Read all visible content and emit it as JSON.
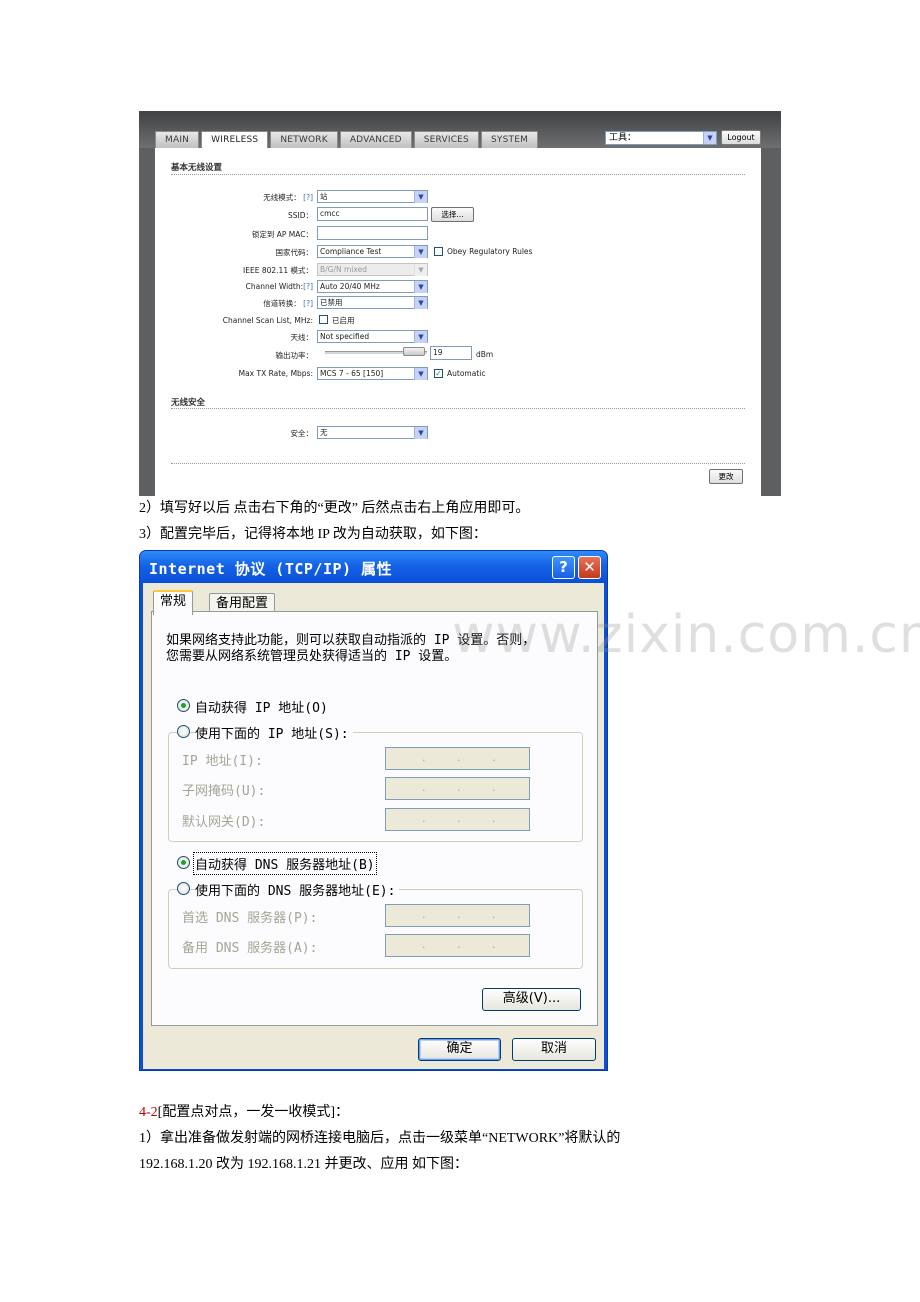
{
  "router": {
    "tabs": [
      "MAIN",
      "WIRELESS",
      "NETWORK",
      "ADVANCED",
      "SERVICES",
      "SYSTEM"
    ],
    "active_tab": "WIRELESS",
    "tools_label": "工具：",
    "logout_label": "Logout",
    "basic_section_title": "基本无线设置",
    "fields": {
      "wireless_mode": {
        "label": "无线模式：",
        "help": "[?]",
        "value": "站"
      },
      "ssid": {
        "label": "SSID：",
        "value": "cmcc",
        "select_button": "选择..."
      },
      "lock_ap_mac": {
        "label": "锁定到 AP MAC：",
        "value": ""
      },
      "country_code": {
        "label": "国家代码：",
        "value": "Compliance Test",
        "checkbox_label": "Obey Regulatory Rules"
      },
      "ieee_mode": {
        "label": "IEEE 802.11 模式：",
        "value": "B/G/N mixed"
      },
      "channel_width": {
        "label": "Channel Width:",
        "help": "[?]",
        "value": "Auto 20/40 MHz"
      },
      "channel_shift": {
        "label": "信道转换：",
        "help": "[?]",
        "value": "已禁用"
      },
      "channel_scan": {
        "label": "Channel Scan List, MHz:",
        "checkbox_label": "已启用"
      },
      "antenna": {
        "label": "天线：",
        "value": "Not specified"
      },
      "output_power": {
        "label": "输出功率：",
        "value": "19",
        "unit": "dBm"
      },
      "max_tx_rate": {
        "label": "Max TX Rate, Mbps:",
        "value": "MCS 7 - 65 [150]",
        "checkbox_label": "Automatic"
      }
    },
    "security_section_title": "无线安全",
    "security": {
      "label": "安全：",
      "value": "无"
    },
    "change_button": "更改"
  },
  "paragraphs": {
    "p2": "2）填写好以后  点击右下角的“更改”    后然点击右上角应用即可。",
    "p3": "3）配置完毕后，记得将本地 IP 改为自动获取，如下图：",
    "section_num": "4-2",
    "section_title": "[配置点对点，一发一收模式]：",
    "p4_line1": "1）拿出准备做发射端的网桥连接电脑后，点击一级菜单“NETWORK”将默认的",
    "p4_line2": "192.168.1.20 改为 192.168.1.21  并更改、应用  如下图："
  },
  "dialog": {
    "title": "Internet 协议 (TCP/IP) 属性",
    "help_glyph": "?",
    "close_glyph": "✕",
    "tabs": [
      "常规",
      "备用配置"
    ],
    "description_line1": "如果网络支持此功能，则可以获取自动指派的 IP 设置。否则，",
    "description_line2": "您需要从网络系统管理员处获得适当的 IP 设置。",
    "auto_ip": "自动获得 IP 地址(O)",
    "manual_ip": "使用下面的 IP 地址(S):",
    "ip_address": "IP 地址(I):",
    "subnet_mask": "子网掩码(U):",
    "gateway": "默认网关(D):",
    "auto_dns": "自动获得 DNS 服务器地址(B)",
    "manual_dns": "使用下面的 DNS 服务器地址(E):",
    "preferred_dns": "首选 DNS 服务器(P):",
    "alternate_dns": "备用 DNS 服务器(A):",
    "ip_dot": ".",
    "advanced_button": "高级(V)...",
    "ok_button": "确定",
    "cancel_button": "取消"
  },
  "watermark": "www.zixin.com.cn"
}
